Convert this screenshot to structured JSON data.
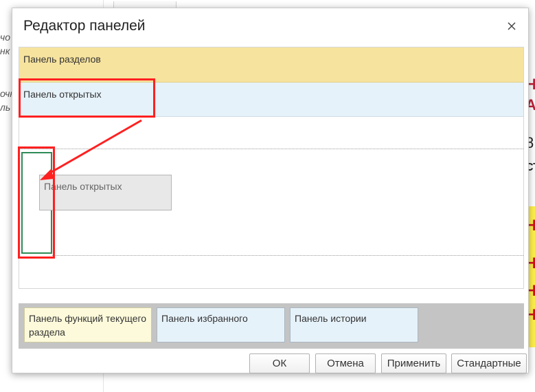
{
  "dialog": {
    "title": "Редактор панелей",
    "sections_panel_label": "Панель разделов",
    "open_panel_label": "Панель открытых",
    "drag_ghost_label": "Панель открытых",
    "available_panels": [
      {
        "label": "Панель функций текущего раздела",
        "color": "#fdfadb"
      },
      {
        "label": "Панель избранного",
        "color": "#e6f2fa"
      },
      {
        "label": "Панель истории",
        "color": "#e6f2fa"
      }
    ],
    "buttons": {
      "ok": "ОК",
      "cancel": "Отмена",
      "apply": "Применить",
      "defaults": "Стандартные"
    }
  },
  "background": {
    "left_fragments": [
      "чо",
      "нк",
      "очн",
      "ль"
    ],
    "right_fragments": [
      "Н",
      "А",
      "8",
      "СТ",
      "Н",
      "Н",
      "Н",
      "Н"
    ]
  },
  "colors": {
    "sections_panel": "#f6e39e",
    "open_panel": "#e6f2fa",
    "highlight": "#ff2020",
    "drop_zone": "#2e8b57"
  },
  "icons": {
    "close": "close-icon"
  }
}
